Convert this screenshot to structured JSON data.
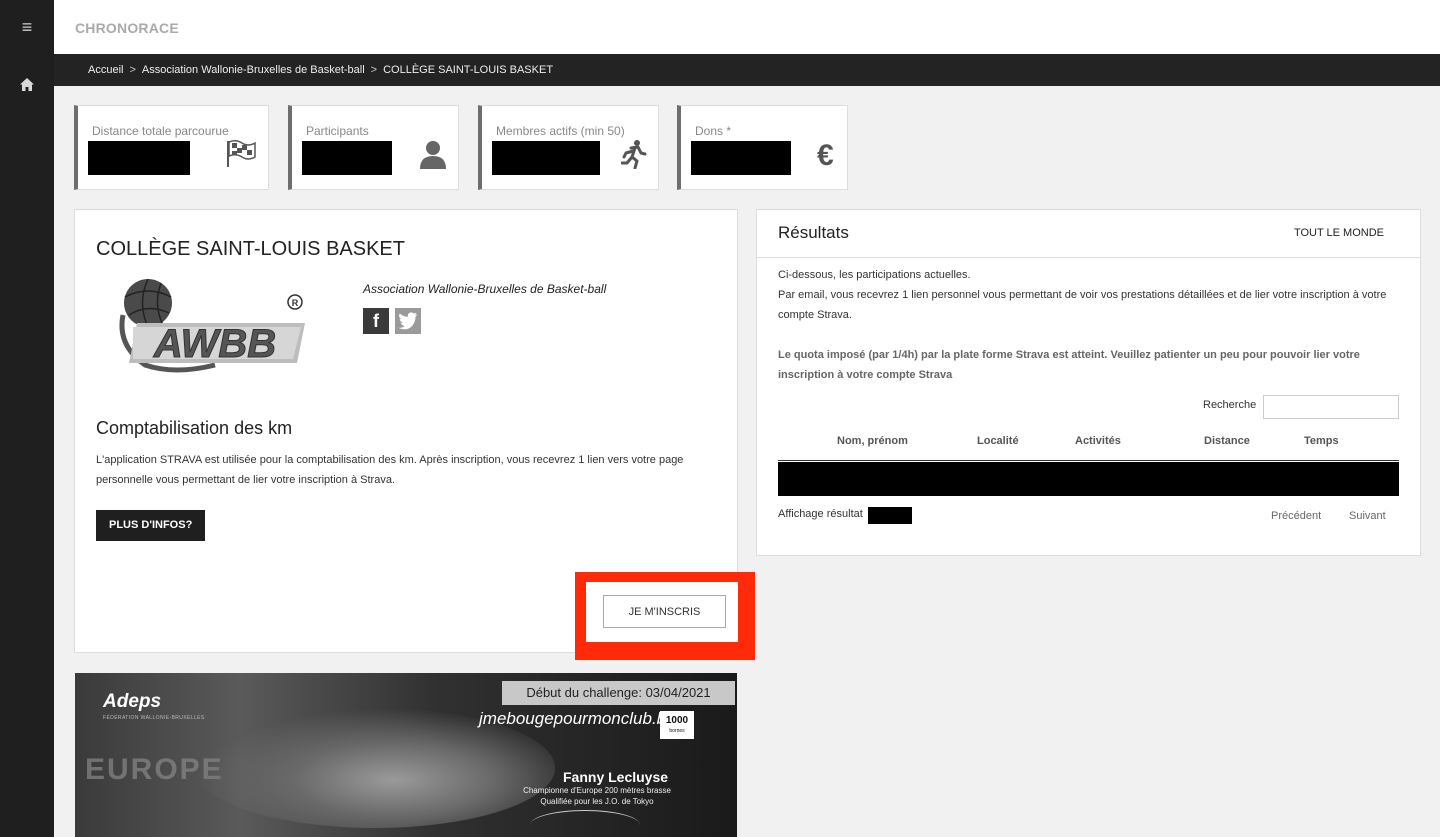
{
  "app": {
    "brand": "CHRONORACE"
  },
  "breadcrumb": {
    "items": [
      "Accueil",
      "Association Wallonie-Bruxelles de Basket-ball",
      "COLLÈGE SAINT-LOUIS BASKET"
    ],
    "separator": ">"
  },
  "stats": [
    {
      "label": "Distance totale parcourue",
      "icon": "checkered-flag-icon"
    },
    {
      "label": "Participants",
      "icon": "user-icon"
    },
    {
      "label": "Membres actifs (min 50)",
      "icon": "runner-icon"
    },
    {
      "label": "Dons *",
      "icon": "euro-icon"
    }
  ],
  "club": {
    "name": "COLLÈGE SAINT-LOUIS BASKET",
    "logo_text": "AWBB",
    "federation": "Association Wallonie-Bruxelles de Basket-ball",
    "km_title": "Comptabilisation des km",
    "km_desc": "L'application STRAVA est utilisée pour la comptabilisation des km. Après inscription, vous recevrez 1 lien vers votre page personnelle vous permettant de lier votre inscription à Strava.",
    "info_button": "PLUS D'INFOS?",
    "join_button": "JE M'INSCRIS"
  },
  "results": {
    "title": "Résultats",
    "filter_tab": "TOUT LE MONDE",
    "intro_line1": "Ci-dessous, les participations actuelles.",
    "intro_line2": "Par email, vous recevrez 1 lien personnel vous permettant de voir vos prestations détaillées et de lier votre inscription à votre compte Strava.",
    "quota_notice": "Le quota imposé (par 1/4h) par la plate forme Strava est atteint. Veuillez patienter un peu pour pouvoir lier votre inscription à votre compte Strava",
    "search_label": "Recherche",
    "search_value": "",
    "columns": [
      "Nom, prénom",
      "Localité",
      "Activités",
      "Distance",
      "Temps"
    ],
    "display_label": "Affichage résultat",
    "prev": "Précédent",
    "next": "Suivant"
  },
  "promo": {
    "date_banner": "Début du challenge: 03/04/2021",
    "adeps": "Adeps",
    "adeps_sub": "FÉDÉRATION WALLONIE-BRUXELLES",
    "site": "jmebougepourmonclub.be",
    "badge_num": "1000",
    "badge_sub": "bornes",
    "bg_text": "EUROPE",
    "athlete": "Fanny Lecluyse",
    "athlete_title1": "Championne d'Europe 200 mètres brasse",
    "athlete_title2": "Qualifiée pour les J.O. de Tokyo"
  },
  "colors": {
    "highlight": "#ff2a0a",
    "sidebar": "#1f1f1f",
    "breadcrumb_bg": "#232323"
  }
}
